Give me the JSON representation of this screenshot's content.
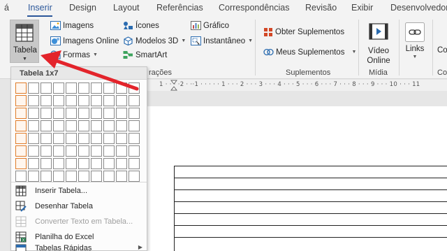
{
  "tabs": [
    {
      "label": "á"
    },
    {
      "label": "Inserir",
      "active": true
    },
    {
      "label": "Design"
    },
    {
      "label": "Layout"
    },
    {
      "label": "Referências"
    },
    {
      "label": "Correspondências"
    },
    {
      "label": "Revisão"
    },
    {
      "label": "Exibir"
    },
    {
      "label": "Desenvolvedor"
    }
  ],
  "ribbon": {
    "tabela_label": "Tabela",
    "ilustracoes": {
      "imagens": "Imagens",
      "imagens_online": "Imagens Online",
      "formas": "Formas",
      "icones": "Ícones",
      "modelos3d": "Modelos 3D",
      "smartart": "SmartArt",
      "grafico": "Gráfico",
      "instantaneo": "Instantâneo",
      "group_label": "rações"
    },
    "suplementos": {
      "obter": "Obter Suplementos",
      "meus": "Meus Suplementos",
      "group_label": "Suplementos"
    },
    "midia": {
      "video_line1": "Vídeo",
      "video_line2": "Online",
      "group_label": "Mídia"
    },
    "links_label": "Links",
    "cut_label": "Co",
    "cut_group": "Co"
  },
  "ruler_text": "1 · · · ·2 · ··1 · · · · · 1 · · · 2 · · · 3 · · · 4 · · · 5 · · · 6 · · · 7 · · · 8 · · · 9 · · · 10 · · · 11",
  "dropdown": {
    "header": "Tabela 1x7",
    "grid_cols": 10,
    "grid_rows": 8,
    "selected_cols": 1,
    "selected_rows": 7,
    "items": [
      {
        "label": "Inserir Tabela...",
        "icon": "insert-table-icon",
        "disabled": false
      },
      {
        "label": "Desenhar Tabela",
        "icon": "draw-table-icon",
        "disabled": false
      },
      {
        "label": "Converter Texto em Tabela...",
        "icon": "convert-text-icon",
        "disabled": true
      },
      {
        "label": "Planilha do Excel",
        "icon": "excel-icon",
        "disabled": false
      },
      {
        "label": "Tabelas Rápidas",
        "icon": "quick-tables-icon",
        "disabled": false,
        "submenu": true
      }
    ]
  },
  "colors": {
    "accent": "#2b579a",
    "selection": "#e07b28",
    "arrow": "#e3242b"
  }
}
